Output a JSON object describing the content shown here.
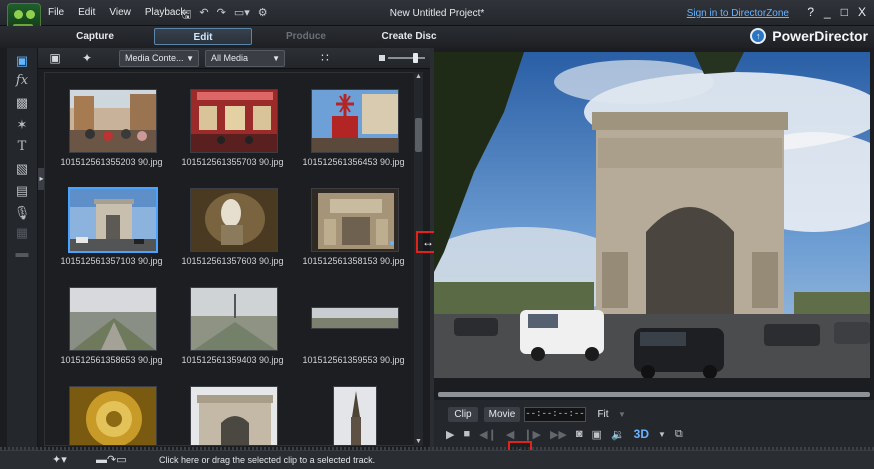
{
  "app": {
    "document_title": "New Untitled Project*",
    "brand": "PowerDirector",
    "signin_link": "Sign in to DirectorZone",
    "window_controls": [
      "?",
      "_",
      "□",
      "X"
    ]
  },
  "menu": [
    "File",
    "Edit",
    "View",
    "Playback"
  ],
  "modes": [
    {
      "label": "Capture",
      "state": "normal"
    },
    {
      "label": "Edit",
      "state": "active"
    },
    {
      "label": "Produce",
      "state": "disabled"
    },
    {
      "label": "Create Disc",
      "state": "normal"
    }
  ],
  "library": {
    "content_dropdown": "Media Conte...",
    "filter_dropdown": "All Media",
    "thumbnail_size_level": 0.72
  },
  "media_items": [
    {
      "filename": "101512561355203 90.jpg",
      "selected": false
    },
    {
      "filename": "101512561355703 90.jpg",
      "selected": false
    },
    {
      "filename": "101512561356453 90.jpg",
      "selected": false
    },
    {
      "filename": "101512561357103 90.jpg",
      "selected": true
    },
    {
      "filename": "101512561357603 90.jpg",
      "selected": false
    },
    {
      "filename": "101512561358153 90.jpg",
      "selected": false
    },
    {
      "filename": "101512561358653 90.jpg",
      "selected": false
    },
    {
      "filename": "101512561359403 90.jpg",
      "selected": false
    },
    {
      "filename": "101512561359553 90.jpg",
      "selected": false
    },
    {
      "filename": "",
      "selected": false
    },
    {
      "filename": "",
      "selected": false
    },
    {
      "filename": "",
      "selected": false
    }
  ],
  "preview": {
    "clip_label": "Clip",
    "movie_label": "Movie",
    "timecode": "--:--:--:--",
    "fit_label": "Fit",
    "td_label": "3D"
  },
  "status": {
    "hint": "Click here or drag the selected clip to a selected track."
  },
  "colors": {
    "accent": "#4aa3ff",
    "highlight_box": "#e2231a",
    "link": "#6ab3ff"
  }
}
